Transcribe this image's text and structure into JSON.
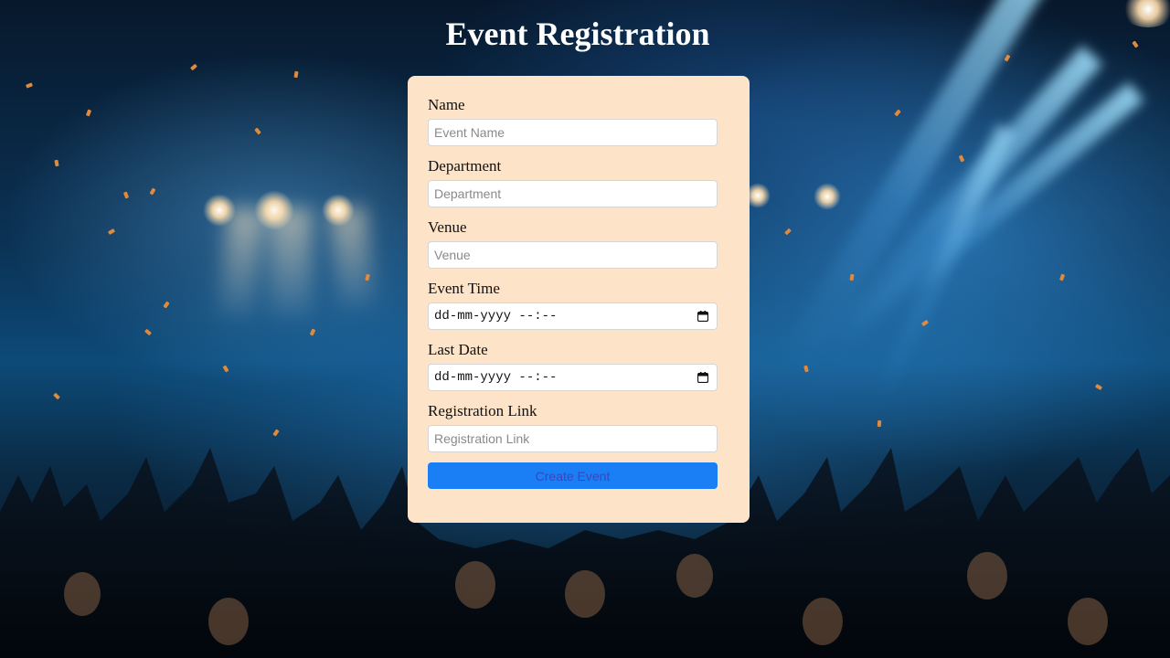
{
  "page": {
    "title": "Event Registration"
  },
  "form": {
    "fields": [
      {
        "label": "Name",
        "placeholder": "Event Name"
      },
      {
        "label": "Department",
        "placeholder": "Department"
      },
      {
        "label": "Venue",
        "placeholder": "Venue"
      },
      {
        "label": "Event Time",
        "value": "dd-mm-yyyy --:--"
      },
      {
        "label": "Last Date",
        "value": "dd-mm-yyyy --:--"
      },
      {
        "label": "Registration Link",
        "placeholder": "Registration Link"
      }
    ],
    "submit_label": "Create Event"
  },
  "icons": {
    "calendar": "calendar-icon"
  },
  "colors": {
    "card_background": "#fde3c8",
    "button": "#1a7ef5",
    "button_text": "#4a3fb8",
    "title": "#ffffff"
  }
}
